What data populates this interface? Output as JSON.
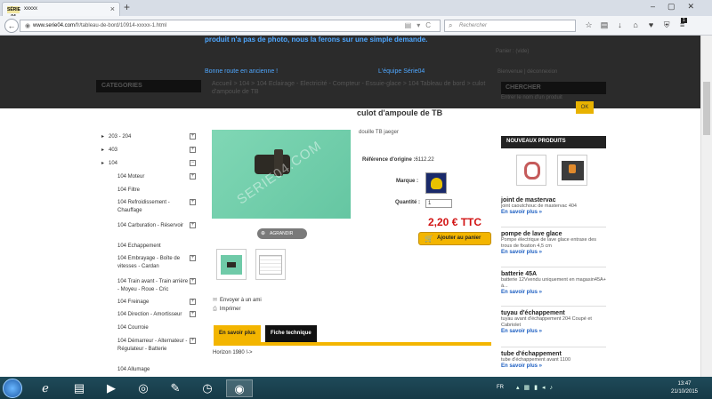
{
  "browser": {
    "tab_favicon": "SÉRIE 04",
    "tab_title": "xxxxx",
    "url_prefix": "www.serie04.com",
    "url_path": "/fr/tableau-de-bord/10914-xxxxx-1.html",
    "search_placeholder": "Rechercher",
    "badge": "1"
  },
  "overlay": {
    "top_text": "produit n'a pas de photo, nous la ferons sur une simple demande.",
    "bonne_route": "Bonne route en ancienne !",
    "team": "L'équipe Série04"
  },
  "header": {
    "categories_title": "CATEGORIES",
    "breadcrumb": "Accueil > 104 > 104 Eclairage - Electricité - Compteur - Essuie-glace > 104 Tableau de bord > culot d'ampoule de TB",
    "cart": "Panier : (vide)",
    "user": "Bienvenue | déconnexion",
    "search_title": "CHERCHER",
    "search_sub": "Entrer le nom d'un produit",
    "ok": "OK"
  },
  "menu": [
    {
      "label": "203 - 204",
      "level": 0,
      "pm": "+"
    },
    {
      "label": "403",
      "level": 0,
      "pm": "+"
    },
    {
      "label": "104",
      "level": 0,
      "pm": "−"
    },
    {
      "label": "104 Moteur",
      "level": 1,
      "pm": "+"
    },
    {
      "label": "104 Filtre",
      "level": 1,
      "pm": ""
    },
    {
      "label": "104 Refroidissement - Chauffage",
      "level": 1,
      "pm": "+"
    },
    {
      "label": "104 Carburation - Réservoir",
      "level": 1,
      "pm": "+"
    },
    {
      "label": "104 Echappement",
      "level": 1,
      "pm": ""
    },
    {
      "label": "104 Embrayage - Boîte de vitesses - Cardan",
      "level": 1,
      "pm": "+"
    },
    {
      "label": "104 Train avant - Train arrière - Moyeu - Roue - Cric",
      "level": 1,
      "pm": "+"
    },
    {
      "label": "104 Freinage",
      "level": 1,
      "pm": "+"
    },
    {
      "label": "104 Direction - Amortisseur",
      "level": 1,
      "pm": "+"
    },
    {
      "label": "104 Courroie",
      "level": 1,
      "pm": ""
    },
    {
      "label": "104 Démarreur - Alternateur - Régulateur - Batterie",
      "level": 1,
      "pm": "+"
    },
    {
      "label": "104 Allumage",
      "level": 1,
      "pm": ""
    },
    {
      "label": "104 Eclairage - Electricité - Compteur - Essuie-glace",
      "level": 1,
      "pm": "−"
    },
    {
      "label": "104 Eclairage",
      "level": 2,
      "pm": ""
    }
  ],
  "product": {
    "title": "culot d'ampoule de TB",
    "watermark": "SERIE04.COM",
    "zoom_label": "AGRANDIR",
    "short_desc": "douille TB jaeger",
    "ref_label": "Référence d'origine :",
    "ref_value": "6112.22",
    "brand_label": "Marque :",
    "qty_label": "Quantité :",
    "qty_value": "1",
    "price": "2,20 € TTC",
    "add_to_cart": "Ajouter au panier",
    "send_friend": "Envoyer à un ami",
    "print": "Imprimer",
    "tab_more": "En savoir plus",
    "tab_tech": "Fiche technique",
    "tab_content": "Horizon 1980 !->"
  },
  "new_products": {
    "title": "NOUVEAUX PRODUITS",
    "items": [
      {
        "name": "joint de mastervac",
        "desc": "joint caoutchouc de mastervac 404",
        "more": "En savoir plus »"
      },
      {
        "name": "pompe de lave glace",
        "desc": "Pompe électrique de lave glace entraxe des trous de fixation 4,5 cm",
        "more": "En savoir plus »"
      },
      {
        "name": "batterie 45A",
        "desc": "batterie 12Vvendu uniquement en magasin45A+ à...",
        "more": "En savoir plus »"
      },
      {
        "name": "tuyau d'échappement",
        "desc": "tuyau avant d'échappement 204 Coupé et Cabriolet",
        "more": "En savoir plus »"
      },
      {
        "name": "tube d'échappement",
        "desc": "tube d'échappement avant 1100",
        "more": "En savoir plus »"
      }
    ]
  },
  "taskbar": {
    "lang": "FR",
    "time": "13:47",
    "date": "21/10/2015"
  }
}
